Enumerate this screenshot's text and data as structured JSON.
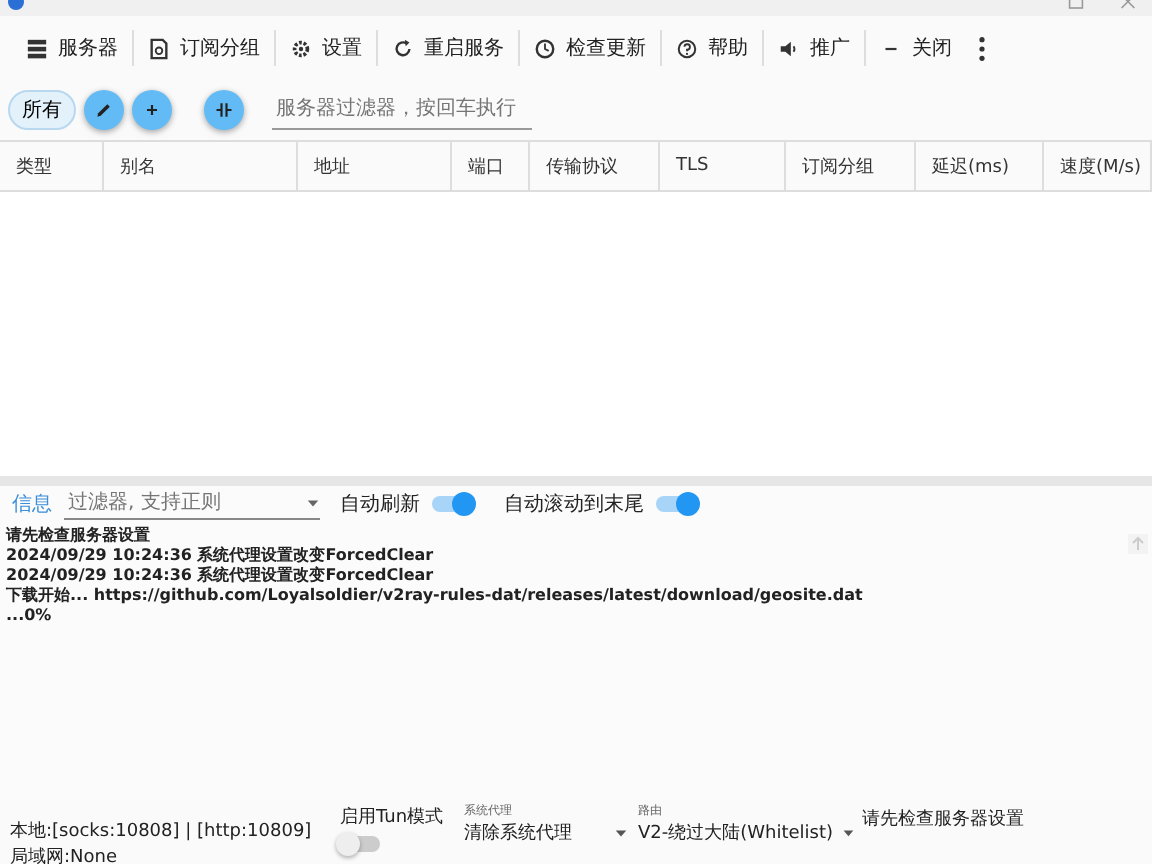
{
  "toolbar": [
    {
      "label": "服务器",
      "kind": "server"
    },
    {
      "label": "订阅分组",
      "kind": "subscription"
    },
    {
      "label": "设置",
      "kind": "gear"
    },
    {
      "label": "重启服务",
      "kind": "refresh"
    },
    {
      "label": "检查更新",
      "kind": "clock"
    },
    {
      "label": "帮助",
      "kind": "help"
    },
    {
      "label": "推广",
      "kind": "speaker"
    },
    {
      "label": "关闭",
      "kind": "minus"
    }
  ],
  "filter_bar": {
    "group_chip": "所有",
    "filter": {
      "placeholder": "服务器过滤器，按回车执行"
    }
  },
  "table": {
    "columns": [
      "类型",
      "别名",
      "地址",
      "端口",
      "传输协议",
      "TLS",
      "订阅分组",
      "延迟(ms)",
      "速度(M/s)"
    ]
  },
  "log_panel": {
    "tab": "信息",
    "filter": {
      "placeholder": "过滤器, 支持正则"
    },
    "toggles": [
      {
        "label": "自动刷新",
        "on": true
      },
      {
        "label": "自动滚动到末尾",
        "on": true
      }
    ],
    "lines": [
      "请先检查服务器设置",
      "2024/09/29 10:24:36 系统代理设置改变ForcedClear",
      "2024/09/29 10:24:36 系统代理设置改变ForcedClear",
      "下载开始...   https://github.com/Loyalsoldier/v2ray-rules-dat/releases/latest/download/geosite.dat",
      "...0%"
    ]
  },
  "status_bar": {
    "local": "本地:[socks:10808] | [http:10809]",
    "lan": "局域网:None",
    "tun": {
      "label": "启用Tun模式",
      "on": false
    },
    "system_proxy": {
      "label": "系统代理",
      "value": "清除系统代理"
    },
    "routing": {
      "label": "路由",
      "value": "V2-绕过大陆(Whitelist)"
    },
    "message": "请先检查服务器设置"
  }
}
